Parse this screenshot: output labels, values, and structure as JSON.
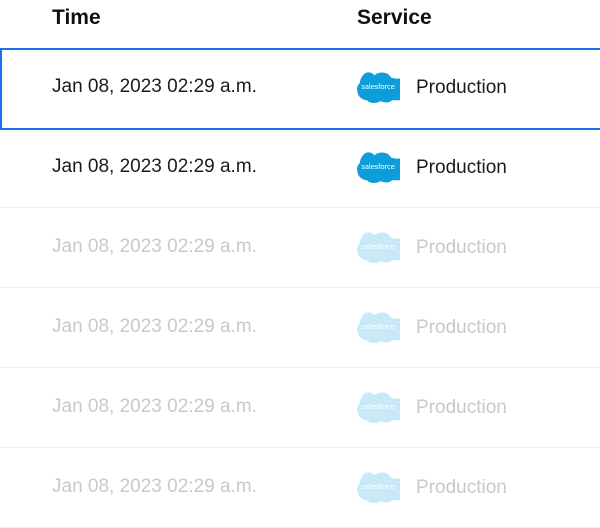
{
  "colors": {
    "accent": "#1a73e8",
    "salesforce_blue": "#0d9dda",
    "text_primary": "#1b1b1b",
    "text_faded": "#c9c9c9"
  },
  "table": {
    "columns": {
      "time": "Time",
      "service": "Service"
    },
    "rows": [
      {
        "time": "Jan 08, 2023 02:29 a.m.",
        "service_logo": "salesforce",
        "service_logo_icon": "salesforce-cloud-icon",
        "environment": "Production",
        "selected": true,
        "faded": false
      },
      {
        "time": "Jan 08, 2023 02:29 a.m.",
        "service_logo": "salesforce",
        "service_logo_icon": "salesforce-cloud-icon",
        "environment": "Production",
        "selected": false,
        "faded": false
      },
      {
        "time": "Jan 08, 2023 02:29 a.m.",
        "service_logo": "salesforce",
        "service_logo_icon": "salesforce-cloud-icon",
        "environment": "Production",
        "selected": false,
        "faded": true
      },
      {
        "time": "Jan 08, 2023 02:29 a.m.",
        "service_logo": "salesforce",
        "service_logo_icon": "salesforce-cloud-icon",
        "environment": "Production",
        "selected": false,
        "faded": true
      },
      {
        "time": "Jan 08, 2023 02:29 a.m.",
        "service_logo": "salesforce",
        "service_logo_icon": "salesforce-cloud-icon",
        "environment": "Production",
        "selected": false,
        "faded": true
      },
      {
        "time": "Jan 08, 2023 02:29 a.m.",
        "service_logo": "salesforce",
        "service_logo_icon": "salesforce-cloud-icon",
        "environment": "Production",
        "selected": false,
        "faded": true
      }
    ]
  }
}
